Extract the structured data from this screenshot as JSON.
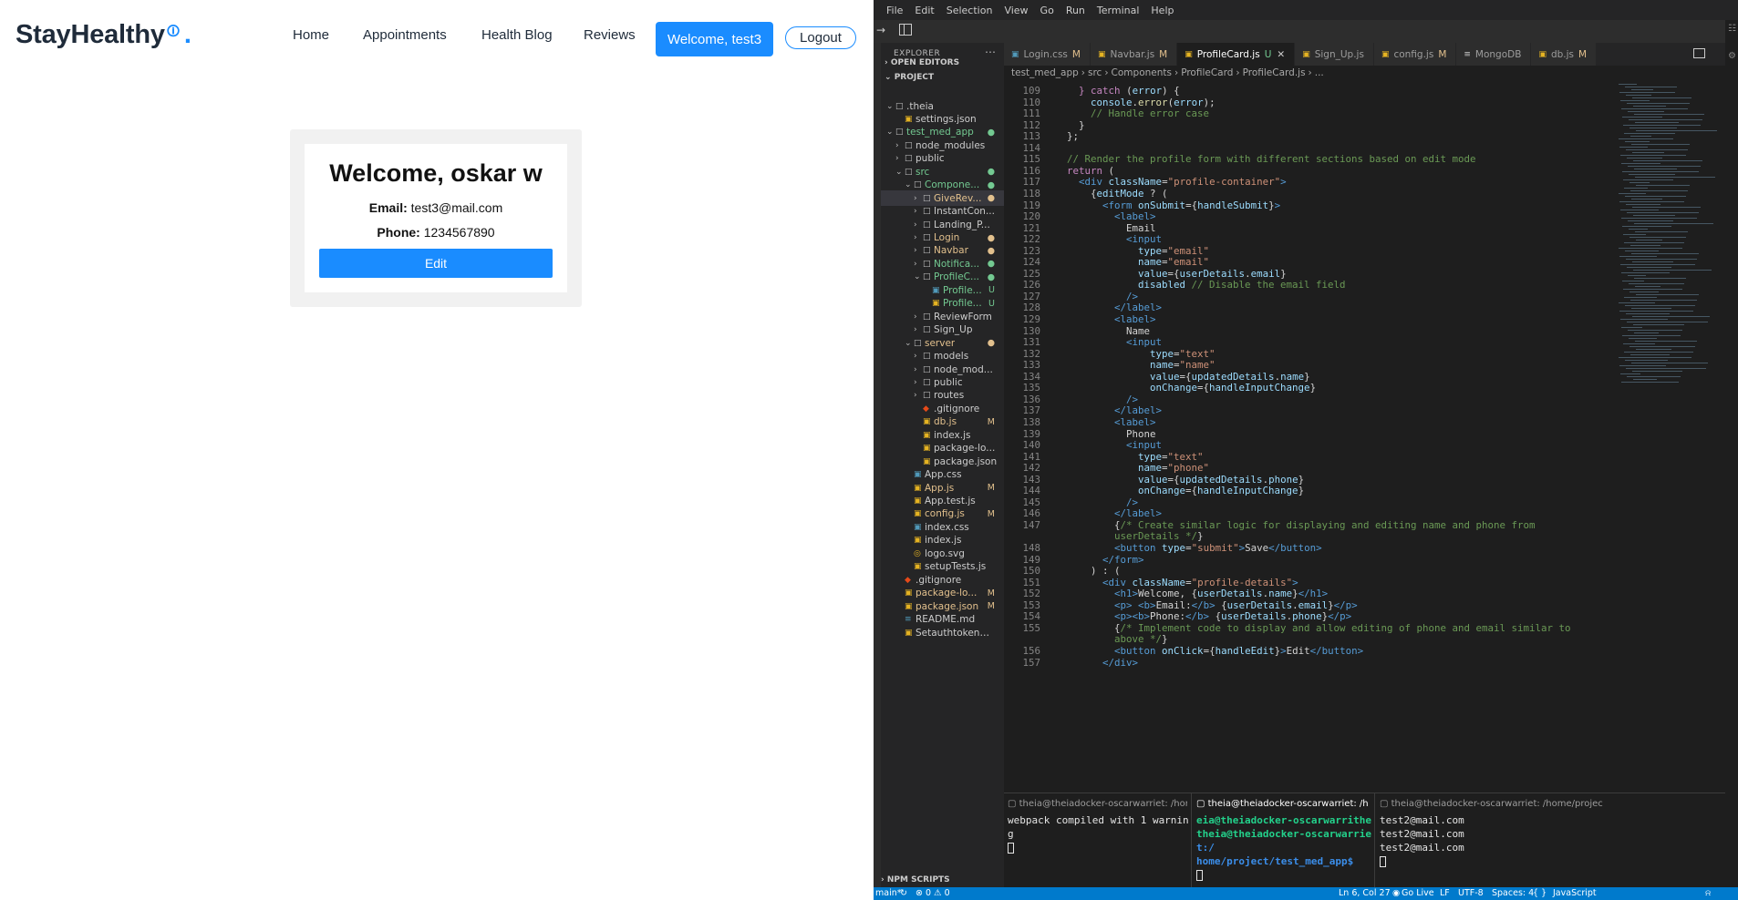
{
  "app": {
    "brand": "StayHealthy",
    "brand_dot": ".",
    "nav": {
      "home": "Home",
      "appointments": "Appointments",
      "health_blog": "Health Blog",
      "reviews": "Reviews"
    },
    "welcome_button": "Welcome, test3",
    "logout_button": "Logout",
    "profile": {
      "title": "Welcome, oskar w",
      "email_label": "Email:",
      "email_value": "test3@mail.com",
      "phone_label": "Phone:",
      "phone_value": "1234567890",
      "edit_button": "Edit"
    },
    "colors": {
      "accent": "#1a8cff",
      "text": "#1f2b3a"
    }
  },
  "ide": {
    "menu": [
      "File",
      "Edit",
      "Selection",
      "View",
      "Go",
      "Run",
      "Terminal",
      "Help"
    ],
    "explorer_title": "EXPLORER",
    "open_editors": "OPEN EDITORS",
    "project": "PROJECT",
    "npm_scripts": "NPM SCRIPTS",
    "tree": [
      {
        "depth": 0,
        "type": "folder",
        "name": ".theia",
        "open": true
      },
      {
        "depth": 1,
        "type": "json",
        "name": "settings.json"
      },
      {
        "depth": 0,
        "type": "folder",
        "name": "test_med_app",
        "open": true,
        "status": "dot-g",
        "color": "c-unt"
      },
      {
        "depth": 1,
        "type": "folder",
        "name": "node_modules"
      },
      {
        "depth": 1,
        "type": "folder",
        "name": "public"
      },
      {
        "depth": 1,
        "type": "folder",
        "name": "src",
        "open": true,
        "status": "dot-g",
        "color": "c-unt"
      },
      {
        "depth": 2,
        "type": "folder",
        "name": "Compone...",
        "open": true,
        "status": "dot-g",
        "color": "c-unt"
      },
      {
        "depth": 3,
        "type": "folder",
        "name": "GiveRev...",
        "status": "dot-y",
        "color": "c-mod",
        "selected": true
      },
      {
        "depth": 3,
        "type": "folder",
        "name": "InstantCon..."
      },
      {
        "depth": 3,
        "type": "folder",
        "name": "Landing_P..."
      },
      {
        "depth": 3,
        "type": "folder",
        "name": "Login",
        "status": "dot-y",
        "color": "c-mod"
      },
      {
        "depth": 3,
        "type": "folder",
        "name": "Navbar",
        "status": "dot-y",
        "color": "c-mod"
      },
      {
        "depth": 3,
        "type": "folder",
        "name": "Notifica...",
        "status": "dot-g",
        "color": "c-unt"
      },
      {
        "depth": 3,
        "type": "folder",
        "name": "ProfileC...",
        "open": true,
        "status": "dot-g",
        "color": "c-unt"
      },
      {
        "depth": 4,
        "type": "css",
        "name": "Profile...",
        "status": "U",
        "color": "c-unt"
      },
      {
        "depth": 4,
        "type": "js",
        "name": "Profile...",
        "status": "U",
        "color": "c-unt"
      },
      {
        "depth": 3,
        "type": "folder",
        "name": "ReviewForm"
      },
      {
        "depth": 3,
        "type": "folder",
        "name": "Sign_Up"
      },
      {
        "depth": 2,
        "type": "folder",
        "name": "server",
        "open": true,
        "status": "dot-y",
        "color": "c-mod"
      },
      {
        "depth": 3,
        "type": "folder",
        "name": "models"
      },
      {
        "depth": 3,
        "type": "folder",
        "name": "node_mod..."
      },
      {
        "depth": 3,
        "type": "folder",
        "name": "public"
      },
      {
        "depth": 3,
        "type": "folder",
        "name": "routes"
      },
      {
        "depth": 3,
        "type": "git",
        "name": ".gitignore"
      },
      {
        "depth": 3,
        "type": "js",
        "name": "db.js",
        "status": "M",
        "color": "c-mod"
      },
      {
        "depth": 3,
        "type": "js",
        "name": "index.js"
      },
      {
        "depth": 3,
        "type": "json",
        "name": "package-lo..."
      },
      {
        "depth": 3,
        "type": "json",
        "name": "package.json"
      },
      {
        "depth": 2,
        "type": "css",
        "name": "App.css"
      },
      {
        "depth": 2,
        "type": "js",
        "name": "App.js",
        "status": "M",
        "color": "c-mod"
      },
      {
        "depth": 2,
        "type": "js",
        "name": "App.test.js"
      },
      {
        "depth": 2,
        "type": "js",
        "name": "config.js",
        "status": "M",
        "color": "c-mod"
      },
      {
        "depth": 2,
        "type": "css",
        "name": "index.css"
      },
      {
        "depth": 2,
        "type": "js",
        "name": "index.js"
      },
      {
        "depth": 2,
        "type": "svg",
        "name": "logo.svg"
      },
      {
        "depth": 2,
        "type": "js",
        "name": "setupTests.js"
      },
      {
        "depth": 1,
        "type": "git",
        "name": ".gitignore"
      },
      {
        "depth": 1,
        "type": "json",
        "name": "package-lo...",
        "status": "M",
        "color": "c-mod"
      },
      {
        "depth": 1,
        "type": "json",
        "name": "package.json",
        "status": "M",
        "color": "c-mod"
      },
      {
        "depth": 1,
        "type": "md",
        "name": "README.md"
      },
      {
        "depth": 1,
        "type": "js",
        "name": "Setauthtoken.js"
      }
    ],
    "tabs": [
      {
        "name": "Login.css",
        "badge": "M",
        "icon": "css"
      },
      {
        "name": "Navbar.js",
        "badge": "M",
        "icon": "js"
      },
      {
        "name": "ProfileCard.js",
        "badge": "U",
        "icon": "js",
        "active": true
      },
      {
        "name": "Sign_Up.js",
        "badge": "",
        "icon": "js"
      },
      {
        "name": "config.js",
        "badge": "M",
        "icon": "js"
      },
      {
        "name": "MongoDB",
        "badge": "",
        "icon": "db"
      },
      {
        "name": "db.js",
        "badge": "M",
        "icon": "js"
      }
    ],
    "breadcrumbs": [
      "test_med_app",
      "src",
      "Components",
      "ProfileCard",
      "ProfileCard.js",
      "..."
    ],
    "code": [
      {
        "n": "109",
        "s": "    <k>}</k> <k>catch</k> (<v>error</v>) {"
      },
      {
        "n": "110",
        "s": "      <v>console</v>.<f>error</f>(<v>error</v>);"
      },
      {
        "n": "111",
        "s": "      <c>// Handle error case</c>"
      },
      {
        "n": "112",
        "s": "    }"
      },
      {
        "n": "113",
        "s": "  };"
      },
      {
        "n": "114",
        "s": ""
      },
      {
        "n": "115",
        "s": "  <c>// Render the profile form with different sections based on edit mode</c>"
      },
      {
        "n": "116",
        "s": "  <k>return</k> ("
      },
      {
        "n": "117",
        "s": "    <t>&lt;div</t> <a>className</a>=<s>\"profile-container\"</s><t>&gt;</t>"
      },
      {
        "n": "118",
        "s": "      {<v>editMode</v> ? ("
      },
      {
        "n": "119",
        "s": "        <t>&lt;form</t> <a>onSubmit</a>={<v>handleSubmit</v>}<t>&gt;</t>"
      },
      {
        "n": "120",
        "s": "          <t>&lt;label&gt;</t>"
      },
      {
        "n": "121",
        "s": "            Email"
      },
      {
        "n": "122",
        "s": "            <t>&lt;input</t>"
      },
      {
        "n": "123",
        "s": "              <a>type</a>=<s>\"email\"</s>"
      },
      {
        "n": "124",
        "s": "              <a>name</a>=<s>\"email\"</s>"
      },
      {
        "n": "125",
        "s": "              <a>value</a>={<v>userDetails</v>.<v>email</v>}"
      },
      {
        "n": "126",
        "s": "              <a>disabled</a> <c>// Disable the email field</c>"
      },
      {
        "n": "127",
        "s": "            <t>/&gt;</t>"
      },
      {
        "n": "128",
        "s": "          <t>&lt;/label&gt;</t>"
      },
      {
        "n": "129",
        "s": "          <t>&lt;label&gt;</t>"
      },
      {
        "n": "130",
        "s": "            Name"
      },
      {
        "n": "131",
        "s": "            <t>&lt;input</t>"
      },
      {
        "n": "132",
        "s": "                <a>type</a>=<s>\"text\"</s>"
      },
      {
        "n": "133",
        "s": "                <a>name</a>=<s>\"name\"</s>"
      },
      {
        "n": "134",
        "s": "                <a>value</a>={<v>updatedDetails</v>.<v>name</v>}"
      },
      {
        "n": "135",
        "s": "                <a>onChange</a>={<v>handleInputChange</v>}"
      },
      {
        "n": "136",
        "s": "            <t>/&gt;</t>"
      },
      {
        "n": "137",
        "s": "          <t>&lt;/label&gt;</t>"
      },
      {
        "n": "138",
        "s": "          <t>&lt;label&gt;</t>"
      },
      {
        "n": "139",
        "s": "            Phone"
      },
      {
        "n": "140",
        "s": "            <t>&lt;input</t>"
      },
      {
        "n": "141",
        "s": "              <a>type</a>=<s>\"text\"</s>"
      },
      {
        "n": "142",
        "s": "              <a>name</a>=<s>\"phone\"</s>"
      },
      {
        "n": "143",
        "s": "              <a>value</a>={<v>updatedDetails</v>.<v>phone</v>}"
      },
      {
        "n": "144",
        "s": "              <a>onChange</a>={<v>handleInputChange</v>}"
      },
      {
        "n": "145",
        "s": "            <t>/&gt;</t>"
      },
      {
        "n": "146",
        "s": "          <t>&lt;/label&gt;</t>"
      },
      {
        "n": "147",
        "s": "          {<c>/* Create similar logic for displaying and editing name and phone from</c>"
      },
      {
        "n": "",
        "s": "          <c>userDetails */</c>}"
      },
      {
        "n": "148",
        "s": "          <t>&lt;button</t> <a>type</a>=<s>\"submit\"</s><t>&gt;</t>Save<t>&lt;/button&gt;</t>"
      },
      {
        "n": "149",
        "s": "        <t>&lt;/form&gt;</t>"
      },
      {
        "n": "150",
        "s": "      ) : ("
      },
      {
        "n": "151",
        "s": "        <t>&lt;div</t> <a>className</a>=<s>\"profile-details\"</s><t>&gt;</t>"
      },
      {
        "n": "152",
        "s": "          <t>&lt;h1&gt;</t>Welcome, {<v>userDetails</v>.<v>name</v>}<t>&lt;/h1&gt;</t>"
      },
      {
        "n": "153",
        "s": "          <t>&lt;p&gt;</t> <t>&lt;b&gt;</t>Email:<t>&lt;/b&gt;</t> {<v>userDetails</v>.<v>email</v>}<t>&lt;/p&gt;</t>"
      },
      {
        "n": "154",
        "s": "          <t>&lt;p&gt;&lt;b&gt;</t>Phone:<t>&lt;/b&gt;</t> {<v>userDetails</v>.<v>phone</v>}<t>&lt;/p&gt;</t>"
      },
      {
        "n": "155",
        "s": "          {<c>/* Implement code to display and allow editing of phone and email similar to</c>"
      },
      {
        "n": "",
        "s": "          <c>above */</c>}"
      },
      {
        "n": "156",
        "s": "          <t>&lt;button</t> <a>onClick</a>={<v>handleEdit</v>}<t>&gt;</t>Edit<t>&lt;/button&gt;</t>"
      },
      {
        "n": "157",
        "s": "        <t>&lt;/div&gt;</t>"
      }
    ],
    "terminals": [
      {
        "title": "theia@theiadocker-oscarwarriet: /hor",
        "lines": [
          "",
          "webpack compiled with 1 warnin",
          "g"
        ]
      },
      {
        "title": "theia@theiadocker-oscarwarriet: /h",
        "active": true,
        "lines": [
          "eia@theiadocker-oscarwarrithe",
          "theia@theiadocker-oscarwarrie",
          "t:/",
          "home/project/test_med_app$ "
        ]
      },
      {
        "title": "theia@theiadocker-oscarwarriet: /home/projec",
        "lines": [
          "test2@mail.com",
          "test2@mail.com",
          "test2@mail.com"
        ]
      }
    ],
    "status": {
      "branch": "main*",
      "problems": "⊗ 0 ⚠ 0",
      "position": "Ln 6, Col 27",
      "golive": "Go Live",
      "eol": "LF",
      "encoding": "UTF-8",
      "spaces": "Spaces: 4",
      "language": "JavaScript"
    },
    "colors": {
      "statusbar": "#007acc",
      "editor_bg": "#1e1e1e",
      "sidebar_bg": "#252526"
    }
  }
}
